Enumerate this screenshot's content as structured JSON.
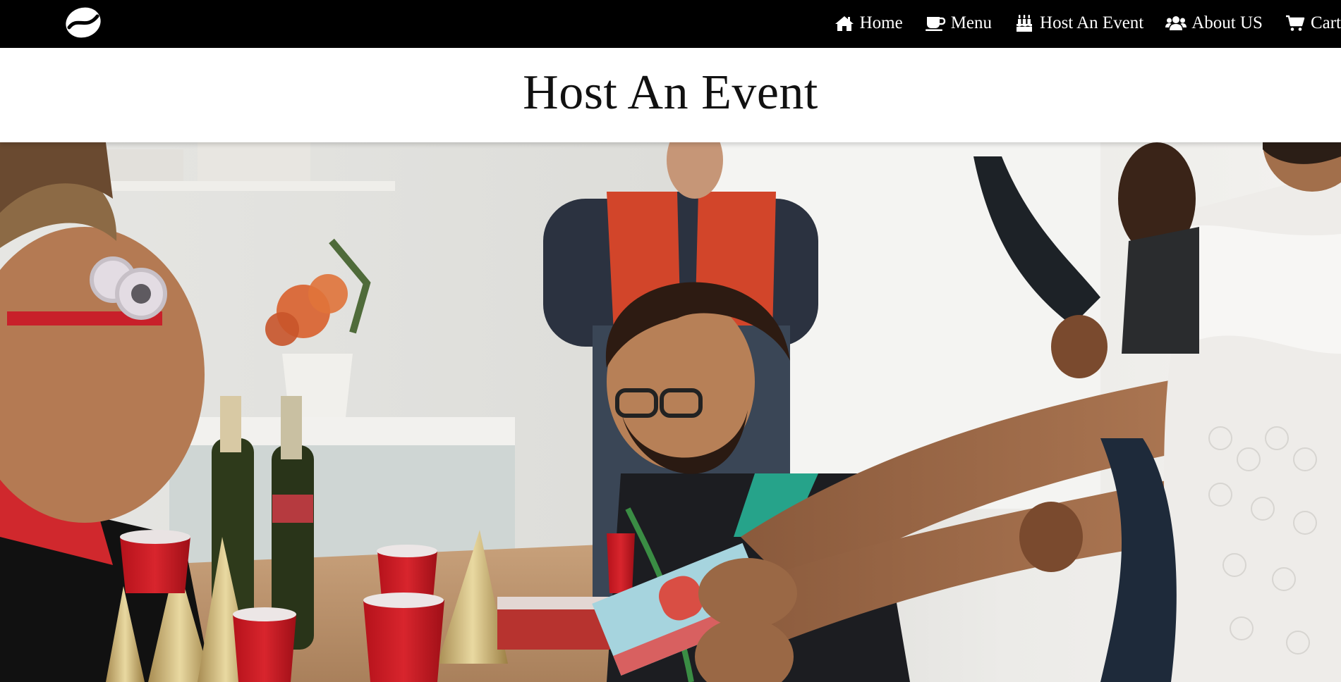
{
  "navbar": {
    "logo_icon": "coffee-bean-icon",
    "items": [
      {
        "label": "Home",
        "icon": "home-icon"
      },
      {
        "label": "Menu",
        "icon": "coffee-cup-icon"
      },
      {
        "label": "Host An Event",
        "icon": "birthday-cake-icon"
      },
      {
        "label": "About US",
        "icon": "users-icon"
      },
      {
        "label": "Cart",
        "icon": "cart-icon"
      }
    ]
  },
  "header": {
    "title": "Host An Event"
  },
  "hero": {
    "description_icon": "party-photo"
  },
  "colors": {
    "navbar_bg": "#000000",
    "nav_text": "#ffffff",
    "title_text": "#111111",
    "page_bg": "#ffffff"
  }
}
